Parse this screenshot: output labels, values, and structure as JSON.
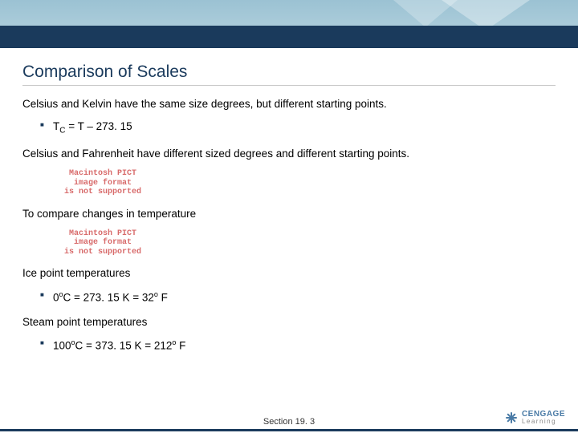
{
  "title": "Comparison of Scales",
  "p1": "Celsius and Kelvin have the same size degrees, but different starting points.",
  "eq1_pre": "T",
  "eq1_sub": "C",
  "eq1_post": " = T – 273. 15",
  "p2": "Celsius and Fahrenheit have different sized degrees and different starting points.",
  "pict_l1": "Macintosh PICT",
  "pict_l2": "image format",
  "pict_l3": "is not supported",
  "p3": "To compare changes in temperature",
  "p4": "Ice point temperatures",
  "eq2_a": "0",
  "eq2_b": "o",
  "eq2_c": "C = 273. 15 K = 32",
  "eq2_d": "o",
  "eq2_e": " F",
  "p5": "Steam point temperatures",
  "eq3_a": "100",
  "eq3_b": "o",
  "eq3_c": "C = 373. 15 K = 212",
  "eq3_d": "o",
  "eq3_e": " F",
  "footer": "Section  19. 3",
  "logo1": "CENGAGE",
  "logo2": "Learning"
}
